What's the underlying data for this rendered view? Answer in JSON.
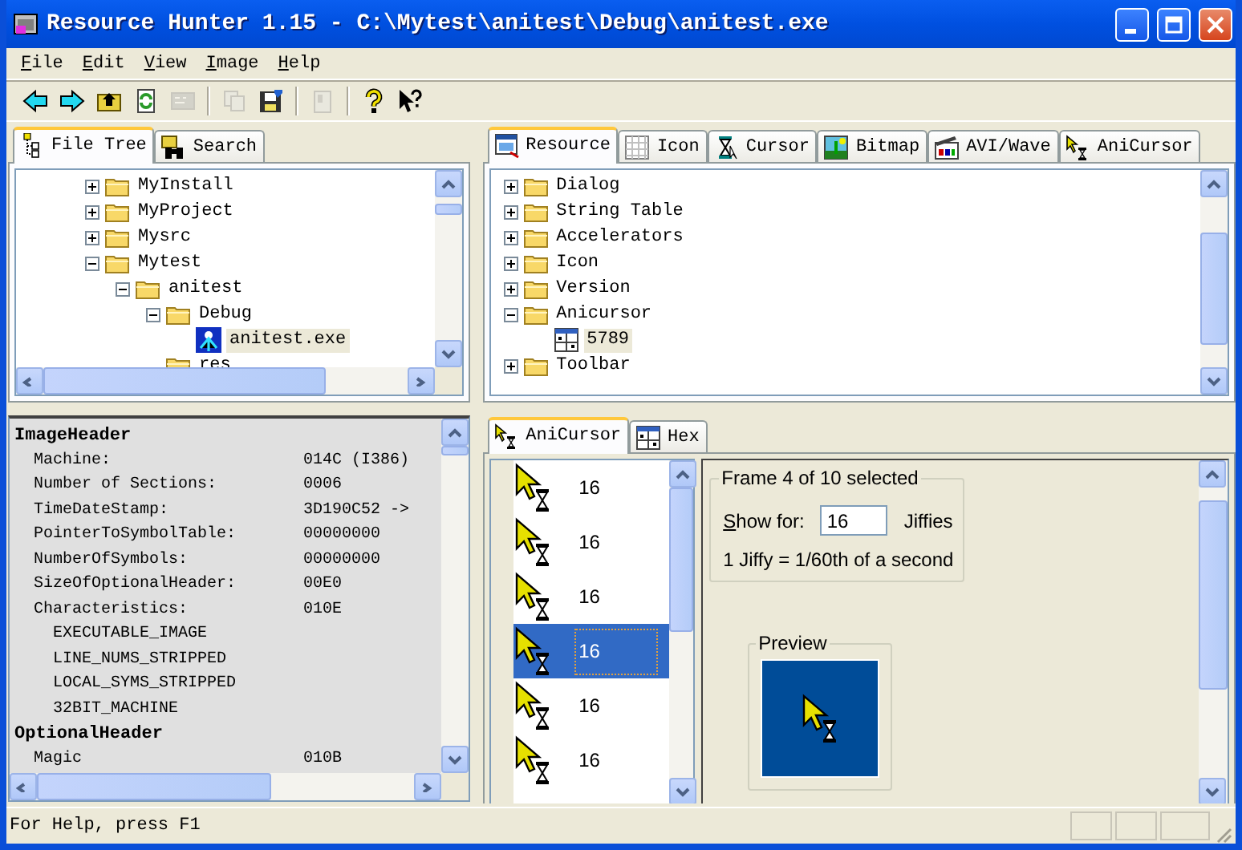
{
  "window": {
    "title": "Resource Hunter 1.15 - C:\\Mytest\\anitest\\Debug\\anitest.exe"
  },
  "menu": [
    {
      "label": "File"
    },
    {
      "label": "Edit"
    },
    {
      "label": "View"
    },
    {
      "label": "Image"
    },
    {
      "label": "Help"
    }
  ],
  "toolbar": [
    {
      "kind": "back",
      "disabled": false
    },
    {
      "kind": "forward",
      "disabled": false
    },
    {
      "kind": "up",
      "disabled": false
    },
    {
      "kind": "refresh",
      "disabled": false
    },
    {
      "kind": "console",
      "disabled": true
    },
    {
      "kind": "separator"
    },
    {
      "kind": "copy",
      "disabled": true
    },
    {
      "kind": "save",
      "disabled": false
    },
    {
      "kind": "separator"
    },
    {
      "kind": "properties",
      "disabled": true
    },
    {
      "kind": "separator"
    },
    {
      "kind": "help",
      "disabled": false
    },
    {
      "kind": "whatsthis",
      "disabled": false
    }
  ],
  "left_tabs": [
    {
      "label": "File Tree",
      "kind": "tree",
      "selected": true
    },
    {
      "label": "Search",
      "kind": "search",
      "selected": false
    }
  ],
  "file_tree": [
    {
      "label": "MyInstall",
      "kind": "folder",
      "expanded": false,
      "selected": false
    },
    {
      "label": "MyProject",
      "kind": "folder",
      "expanded": false,
      "selected": false
    },
    {
      "label": "Mysrc",
      "kind": "folder",
      "expanded": false,
      "selected": false
    },
    {
      "label": "Mytest",
      "kind": "folder",
      "expanded": true,
      "selected": false,
      "children": [
        {
          "label": "anitest",
          "kind": "folder",
          "expanded": true,
          "selected": false,
          "children": [
            {
              "label": "Debug",
              "kind": "folder",
              "expanded": true,
              "selected": false,
              "children": [
                {
                  "label": "anitest.exe",
                  "kind": "exe",
                  "selected": true
                }
              ]
            },
            {
              "label": "res",
              "kind": "folder",
              "selected": false
            }
          ]
        }
      ]
    }
  ],
  "header_info": [
    {
      "kind": "section",
      "label": "ImageHeader"
    },
    {
      "kind": "field",
      "label": "Machine:",
      "value": "014C (I386)"
    },
    {
      "kind": "field",
      "label": "Number of Sections:",
      "value": "0006"
    },
    {
      "kind": "field",
      "label": "TimeDateStamp:",
      "value": "3D190C52 ->"
    },
    {
      "kind": "field",
      "label": "PointerToSymbolTable:",
      "value": "00000000"
    },
    {
      "kind": "field",
      "label": "NumberOfSymbols:",
      "value": "00000000"
    },
    {
      "kind": "field",
      "label": "SizeOfOptionalHeader:",
      "value": "00E0"
    },
    {
      "kind": "field",
      "label": "Characteristics:",
      "value": "010E"
    },
    {
      "kind": "flag",
      "label": "EXECUTABLE_IMAGE"
    },
    {
      "kind": "flag",
      "label": "LINE_NUMS_STRIPPED"
    },
    {
      "kind": "flag",
      "label": "LOCAL_SYMS_STRIPPED"
    },
    {
      "kind": "flag",
      "label": "32BIT_MACHINE"
    },
    {
      "kind": "section",
      "label": "OptionalHeader"
    },
    {
      "kind": "field",
      "label": "Magic",
      "value": "010B"
    }
  ],
  "right_tabs": [
    {
      "label": "Resource",
      "kind": "resource",
      "selected": true
    },
    {
      "label": "Icon",
      "kind": "icon",
      "selected": false
    },
    {
      "label": "Cursor",
      "kind": "cursor",
      "selected": false
    },
    {
      "label": "Bitmap",
      "kind": "bitmap",
      "selected": false
    },
    {
      "label": "AVI/Wave",
      "kind": "avi",
      "selected": false
    },
    {
      "label": "AniCursor",
      "kind": "anicursor",
      "selected": false
    }
  ],
  "resource_tree": [
    {
      "label": "Dialog",
      "kind": "folder",
      "expanded": false,
      "selected": false
    },
    {
      "label": "String Table",
      "kind": "folder",
      "expanded": false,
      "selected": false
    },
    {
      "label": "Accelerators",
      "kind": "folder",
      "expanded": false,
      "selected": false
    },
    {
      "label": "Icon",
      "kind": "folder",
      "expanded": false,
      "selected": false
    },
    {
      "label": "Version",
      "kind": "folder",
      "expanded": false,
      "selected": false
    },
    {
      "label": "Anicursor",
      "kind": "folder",
      "expanded": true,
      "selected": false,
      "children": [
        {
          "label": "5789",
          "kind": "resource",
          "selected": true
        }
      ]
    },
    {
      "label": "Toolbar",
      "kind": "folder",
      "expanded": false,
      "selected": false
    }
  ],
  "detail_tabs": [
    {
      "label": "AniCursor",
      "kind": "anicursor",
      "selected": true
    },
    {
      "label": "Hex",
      "kind": "hex",
      "selected": false
    }
  ],
  "frames": [
    {
      "duration": "16",
      "selected": false
    },
    {
      "duration": "16",
      "selected": false
    },
    {
      "duration": "16",
      "selected": false
    },
    {
      "duration": "16",
      "selected": true
    },
    {
      "duration": "16",
      "selected": false
    },
    {
      "duration": "16",
      "selected": false
    }
  ],
  "frame_group": {
    "title": "Frame 4 of 10 selected",
    "show_for_label": "Show for:",
    "show_for_value": "16",
    "unit": "Jiffies",
    "note": "1 Jiffy = 1/60th of a second"
  },
  "preview": {
    "title": "Preview"
  },
  "status_bar": {
    "text": "For Help, press F1"
  }
}
